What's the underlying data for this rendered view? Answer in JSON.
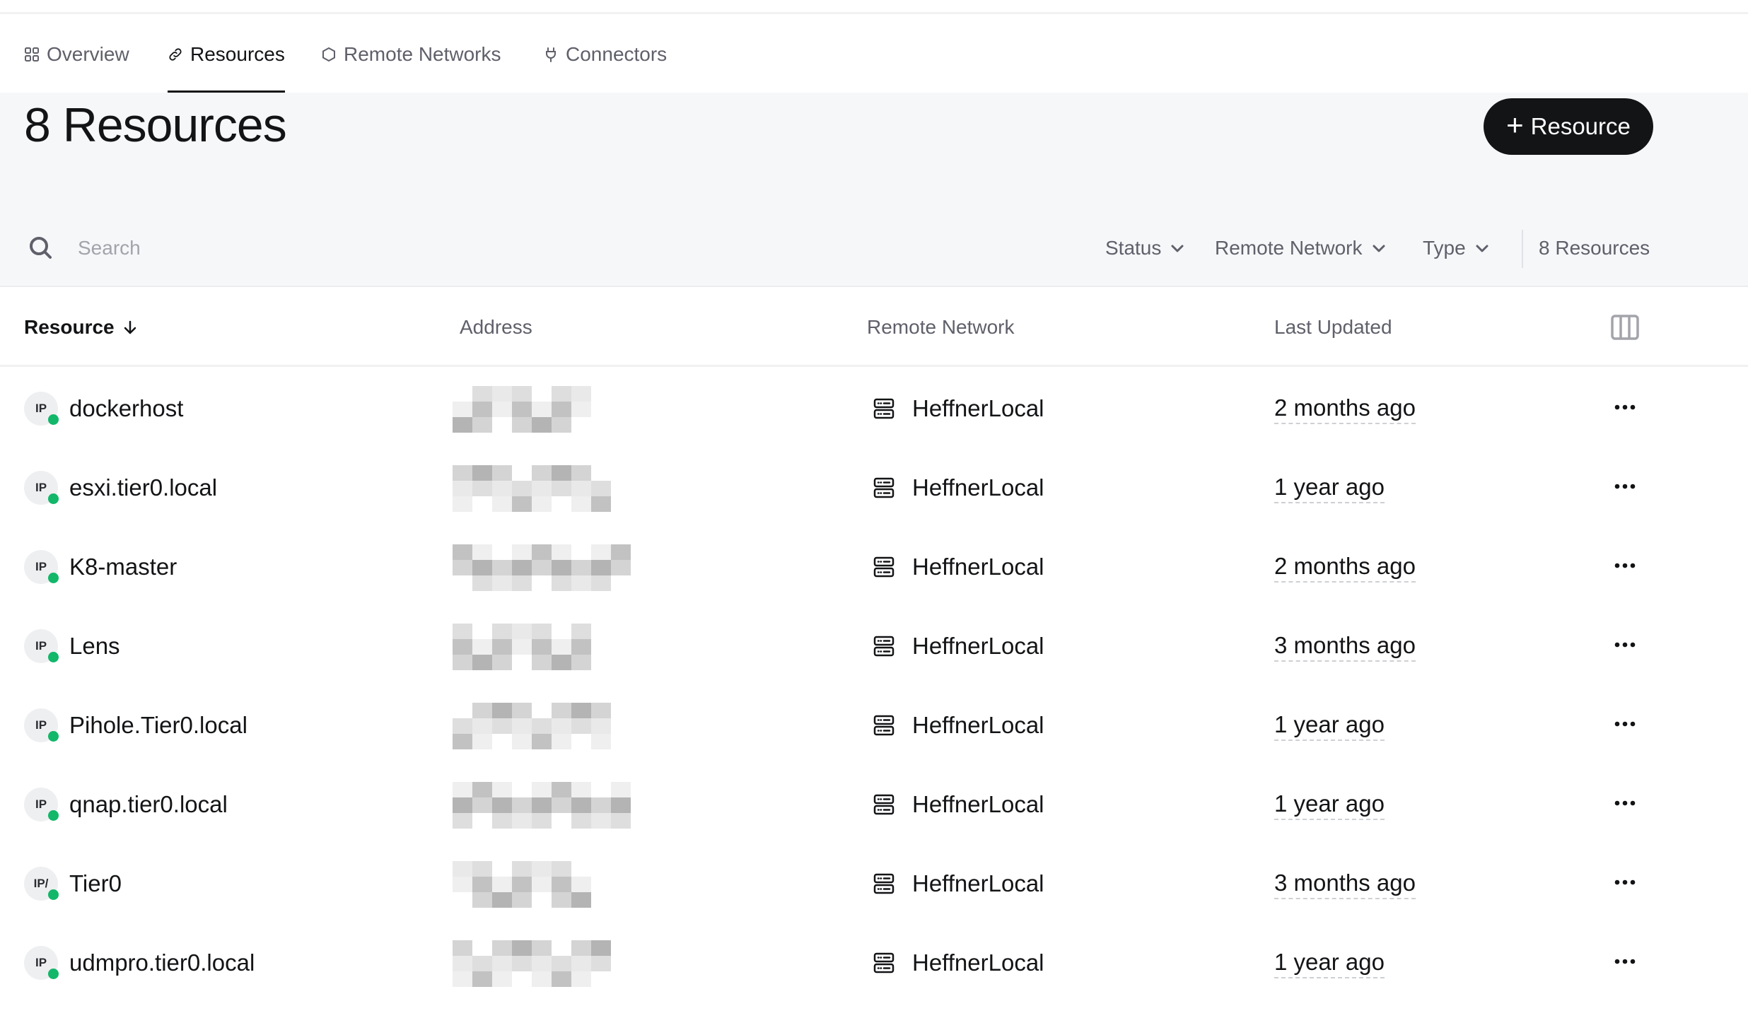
{
  "tabs": [
    {
      "label": "Overview",
      "icon": "grid-icon",
      "active": false
    },
    {
      "label": "Resources",
      "icon": "link-icon",
      "active": true
    },
    {
      "label": "Remote Networks",
      "icon": "hexagon-icon",
      "active": false
    },
    {
      "label": "Connectors",
      "icon": "plug-icon",
      "active": false
    }
  ],
  "header": {
    "title": "8 Resources",
    "add_button_label": "Resource",
    "add_button_icon": "plus-icon"
  },
  "search": {
    "placeholder": "Search",
    "value": ""
  },
  "filters": [
    {
      "label": "Status"
    },
    {
      "label": "Remote Network"
    },
    {
      "label": "Type"
    }
  ],
  "result_count": "8 Resources",
  "table": {
    "columns": [
      "Resource",
      "Address",
      "Remote Network",
      "Last Updated"
    ],
    "sort": {
      "column": "Resource",
      "direction": "descending-arrow"
    },
    "rows": [
      {
        "type": "IP",
        "status": "online",
        "name": "dockerhost",
        "address": "[redacted]",
        "remote_network": "HeffnerLocal",
        "last_updated": "2 months ago"
      },
      {
        "type": "IP",
        "status": "online",
        "name": "esxi.tier0.local",
        "address": "[redacted]",
        "remote_network": "HeffnerLocal",
        "last_updated": "1 year ago"
      },
      {
        "type": "IP",
        "status": "online",
        "name": "K8-master",
        "address": "[redacted]",
        "remote_network": "HeffnerLocal",
        "last_updated": "2 months ago"
      },
      {
        "type": "IP",
        "status": "online",
        "name": "Lens",
        "address": "[redacted]",
        "remote_network": "HeffnerLocal",
        "last_updated": "3 months ago"
      },
      {
        "type": "IP",
        "status": "online",
        "name": "Pihole.Tier0.local",
        "address": "[redacted]",
        "remote_network": "HeffnerLocal",
        "last_updated": "1 year ago"
      },
      {
        "type": "IP",
        "status": "online",
        "name": "qnap.tier0.local",
        "address": "[redacted]",
        "remote_network": "HeffnerLocal",
        "last_updated": "1 year ago"
      },
      {
        "type": "IP/",
        "status": "online",
        "name": "Tier0",
        "address": "[redacted]",
        "remote_network": "HeffnerLocal",
        "last_updated": "3 months ago"
      },
      {
        "type": "IP",
        "status": "online",
        "name": "udmpro.tier0.local",
        "address": "[redacted]",
        "remote_network": "HeffnerLocal",
        "last_updated": "1 year ago"
      }
    ]
  },
  "colors": {
    "accent": "#131416",
    "status_online": "#12b76a",
    "header_band": "#f6f7f9",
    "muted_text": "#5f606a"
  }
}
